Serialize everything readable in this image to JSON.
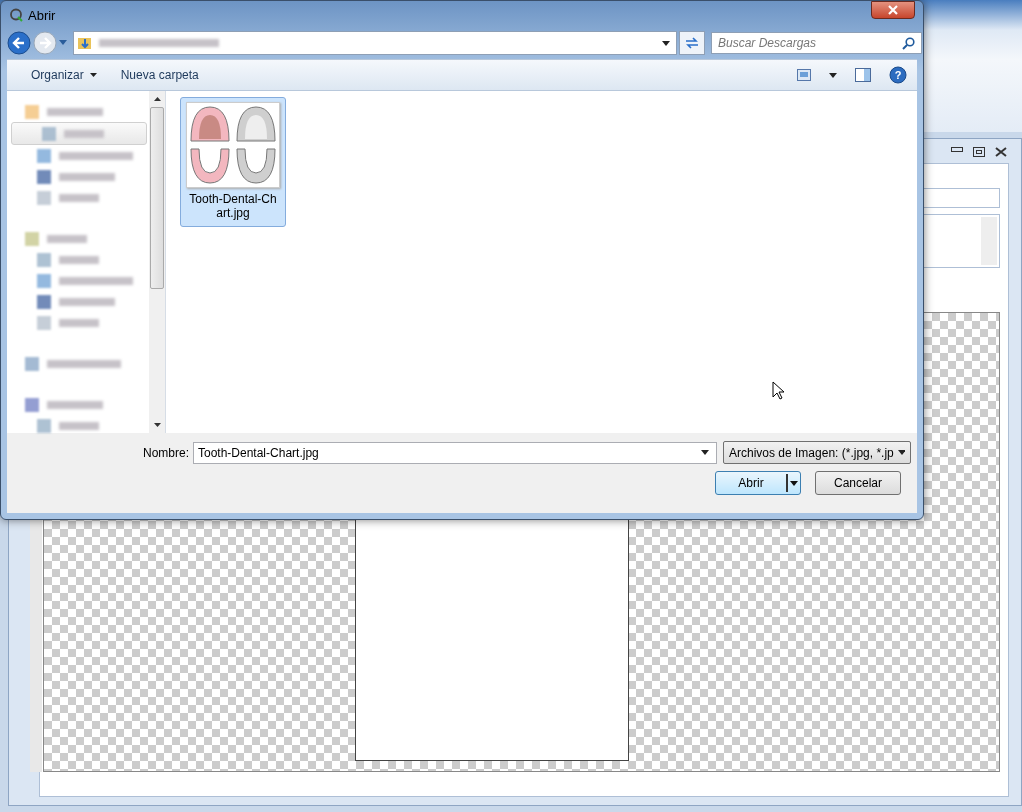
{
  "dialog": {
    "title": "Abrir",
    "search": {
      "placeholder": "Buscar Descargas"
    },
    "toolbar": [
      "Organizar",
      "Nueva carpeta"
    ],
    "help": "?",
    "sidebar": {
      "groups": [
        {
          "selected": false,
          "children": [
            {
              "selected": true
            },
            {
              "selected": false
            },
            {
              "selected": false
            },
            {
              "selected": false
            }
          ]
        },
        {
          "selected": false,
          "children": [
            {
              "selected": false
            },
            {
              "selected": false
            },
            {
              "selected": false
            },
            {
              "selected": false
            }
          ]
        },
        {
          "selected": false
        },
        {
          "selected": false,
          "children": [
            {
              "selected": false
            }
          ]
        }
      ]
    },
    "files": [
      {
        "name": "Tooth-Dental-Chart.jpg",
        "selected": true
      }
    ],
    "filename": {
      "label": "Nombre:",
      "value": "Tooth-Dental-Chart.jpg"
    },
    "filter": "Archivos de Imagen: (*.jpg, *.jp",
    "buttons": [
      "Abrir",
      "Cancelar"
    ]
  }
}
